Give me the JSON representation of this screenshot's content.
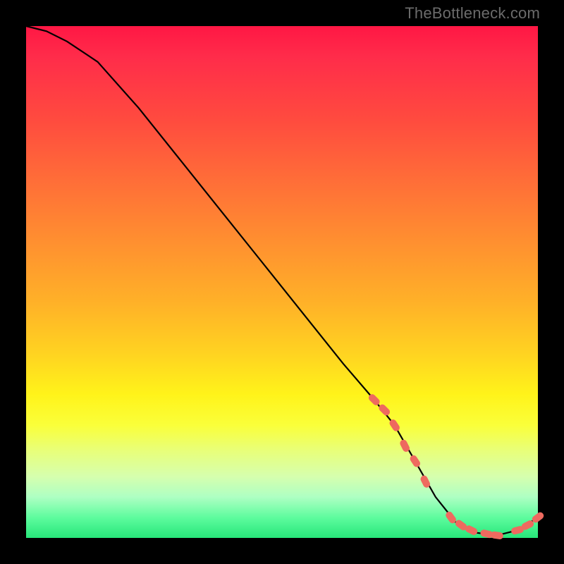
{
  "watermark": {
    "text": "TheBottleneck.com"
  },
  "chart_data": {
    "type": "line",
    "title": "",
    "xlabel": "",
    "ylabel": "",
    "xlim": [
      0,
      100
    ],
    "ylim": [
      0,
      100
    ],
    "series": [
      {
        "name": "curve",
        "x": [
          0,
          4,
          8,
          14,
          22,
          30,
          38,
          46,
          54,
          62,
          68,
          72,
          76,
          80,
          84,
          88,
          92,
          96,
          100
        ],
        "y": [
          100,
          99,
          97,
          93,
          84,
          74,
          64,
          54,
          44,
          34,
          27,
          22,
          15,
          8,
          3,
          1,
          0.5,
          1.5,
          4
        ]
      }
    ],
    "markers": {
      "name": "highlight-points",
      "color": "#ee6a5f",
      "x": [
        68,
        70,
        72,
        74,
        76,
        78,
        83,
        85,
        87,
        90,
        92,
        96,
        98,
        100
      ],
      "y": [
        27,
        25,
        22,
        18,
        15,
        11,
        4,
        2.5,
        1.5,
        0.8,
        0.5,
        1.5,
        2.5,
        4
      ]
    }
  }
}
